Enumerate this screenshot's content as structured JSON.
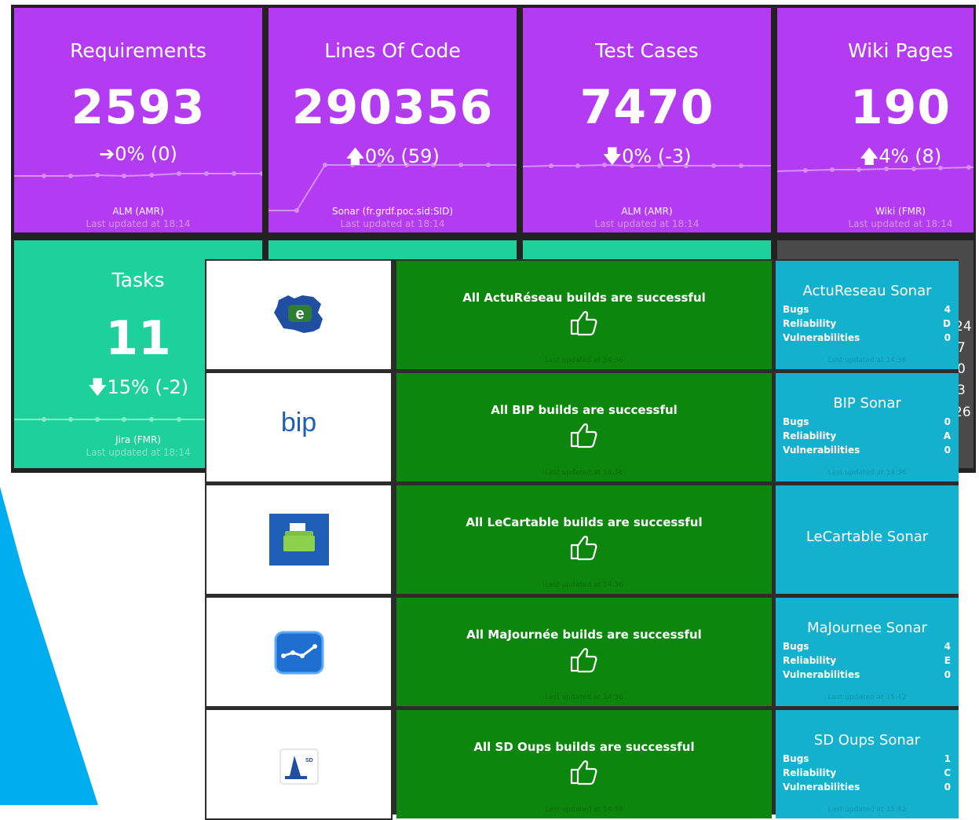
{
  "tiles": [
    {
      "title": "Requirements",
      "value": "2593",
      "change": "➔0% (0)",
      "source": "ALM (AMR)",
      "updated": "Last updated at 18:14"
    },
    {
      "title": "Lines Of Code",
      "value": "290356",
      "change": "🡅0% (59)",
      "source": "Sonar (fr.grdf.poc.sid:SID)",
      "updated": "Last updated at 18:14"
    },
    {
      "title": "Test Cases",
      "value": "7470",
      "change": "🡇0% (-3)",
      "source": "ALM (AMR)",
      "updated": "Last updated at 18:14"
    },
    {
      "title": "Wiki Pages",
      "value": "190",
      "change": "🡅4% (8)",
      "source": "Wiki (FMR)",
      "updated": "Last updated at 18:14"
    },
    {
      "title": "Tasks",
      "value": "11",
      "change": "🡇15% (-2)",
      "source": "Jira (FMR)",
      "updated": "Last updated at 18:14"
    }
  ],
  "partial_numbers": [
    "24",
    "7",
    "0",
    "3",
    "26"
  ],
  "projects": [
    {
      "logo_icon": "france-map-logo-icon",
      "build_text": "All ActuRéseau builds are successful",
      "build_updated": "Last updated at 14:36",
      "sonar_title": "ActuReseau Sonar",
      "bugs": "4",
      "reliability": "D",
      "vulnerabilities": "0",
      "sonar_updated": "Last updated at 14:36"
    },
    {
      "logo_icon": "bip-logo-icon",
      "logo_text": "bip",
      "build_text": "All BIP builds are successful",
      "build_updated": "Last updated at 14:36",
      "sonar_title": "BIP Sonar",
      "bugs": "0",
      "reliability": "A",
      "vulnerabilities": "0",
      "sonar_updated": "Last updated at 14:36"
    },
    {
      "logo_icon": "folder-logo-icon",
      "build_text": "All LeCartable builds are successful",
      "build_updated": "Last updated at 14:36",
      "sonar_title": "LeCartable Sonar"
    },
    {
      "logo_icon": "chart-line-logo-icon",
      "build_text": "All MaJournée builds are successful",
      "build_updated": "Last updated at 14:36",
      "sonar_title": "MaJournee Sonar",
      "bugs": "4",
      "reliability": "E",
      "vulnerabilities": "0",
      "sonar_updated": "Last updated at 15:42"
    },
    {
      "logo_icon": "cone-logo-icon",
      "logo_text": "SD",
      "build_text": "All SD Oups builds are successful",
      "build_updated": "Last updated at 14:36",
      "sonar_title": "SD Oups Sonar",
      "bugs": "1",
      "reliability": "C",
      "vulnerabilities": "0",
      "sonar_updated": "Last updated at 15:42"
    }
  ],
  "labels": {
    "bugs": "Bugs",
    "reliability": "Reliability",
    "vulnerabilities": "Vulnerabilities"
  },
  "colors": {
    "purple": "#b33cf2",
    "teal": "#1ed19c",
    "build_green": "#0d860d",
    "sonar_blue": "#13b1ce",
    "accent_blue": "#00aeef"
  }
}
